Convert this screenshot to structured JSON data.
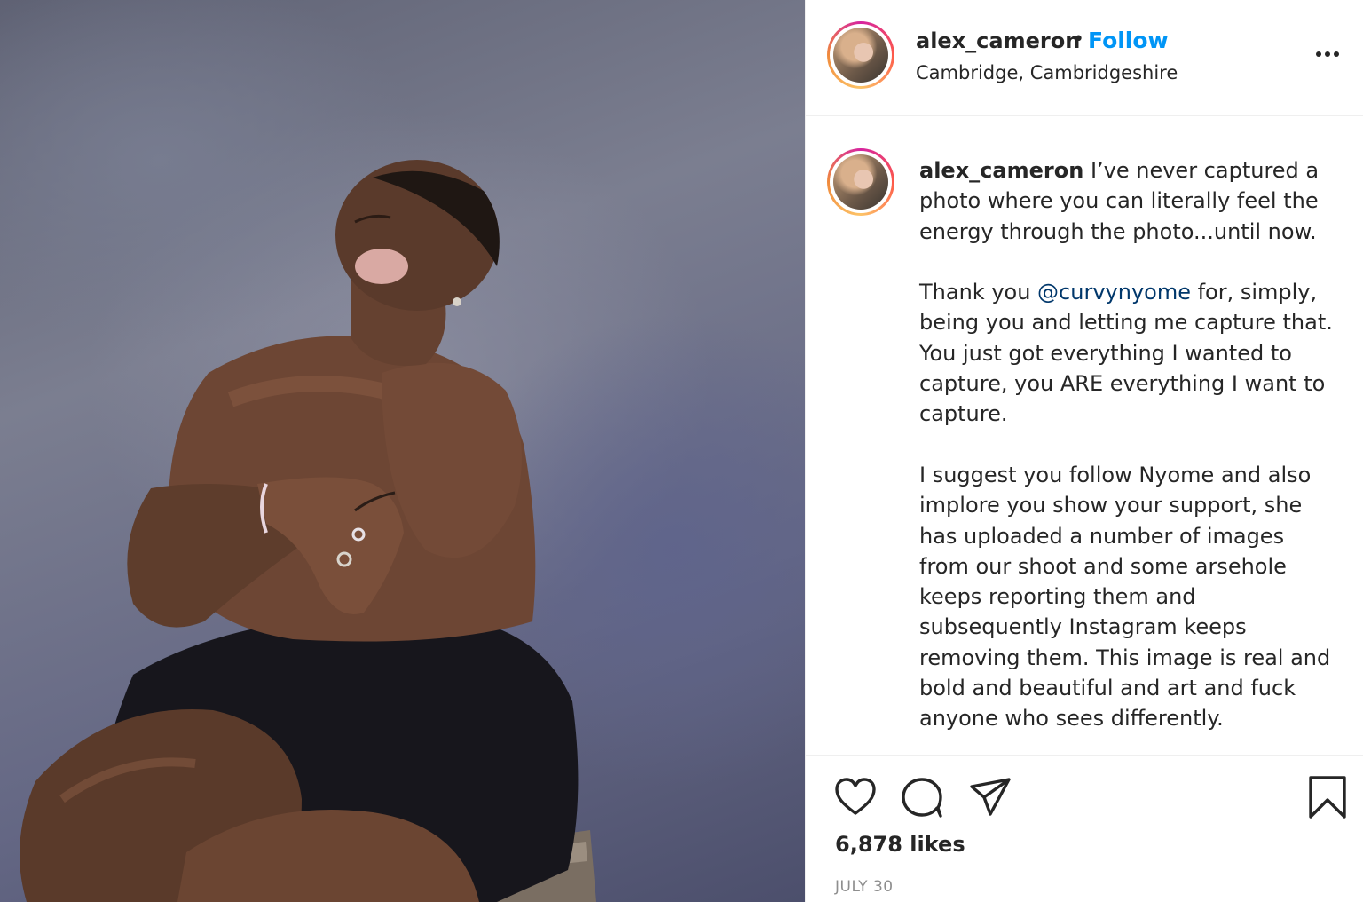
{
  "post": {
    "username": "alex_cameron",
    "separator": "•",
    "follow_label": "Follow",
    "location": "Cambridge, Cambridgeshire"
  },
  "caption": {
    "username": "alex_cameron",
    "p1": "I’ve never captured a photo where you can literally feel the energy through the photo...until now.",
    "p2_before": "Thank you ",
    "p2_mention": "@curvynyome",
    "p2_after": " for, simply, being you and letting me capture that. You just got everything I wanted to capture, you ARE everything I want to capture.",
    "p3": "I suggest you follow Nyome and also implore you show your support, she has uploaded a number of images from our shoot and some arsehole keeps reporting them and subsequently Instagram keeps removing them. This image is real and bold and beautiful and art and fuck anyone who sees differently."
  },
  "actions": {
    "likes": "6,878 likes",
    "date": "JULY 30",
    "icons": [
      "heart-icon",
      "comment-icon",
      "share-icon",
      "bookmark-icon",
      "more-icon"
    ]
  },
  "colors": {
    "accent": "#0095f6",
    "mention": "#00376b",
    "text": "#262626",
    "muted": "#8e8e8e",
    "divider": "#efefef"
  }
}
